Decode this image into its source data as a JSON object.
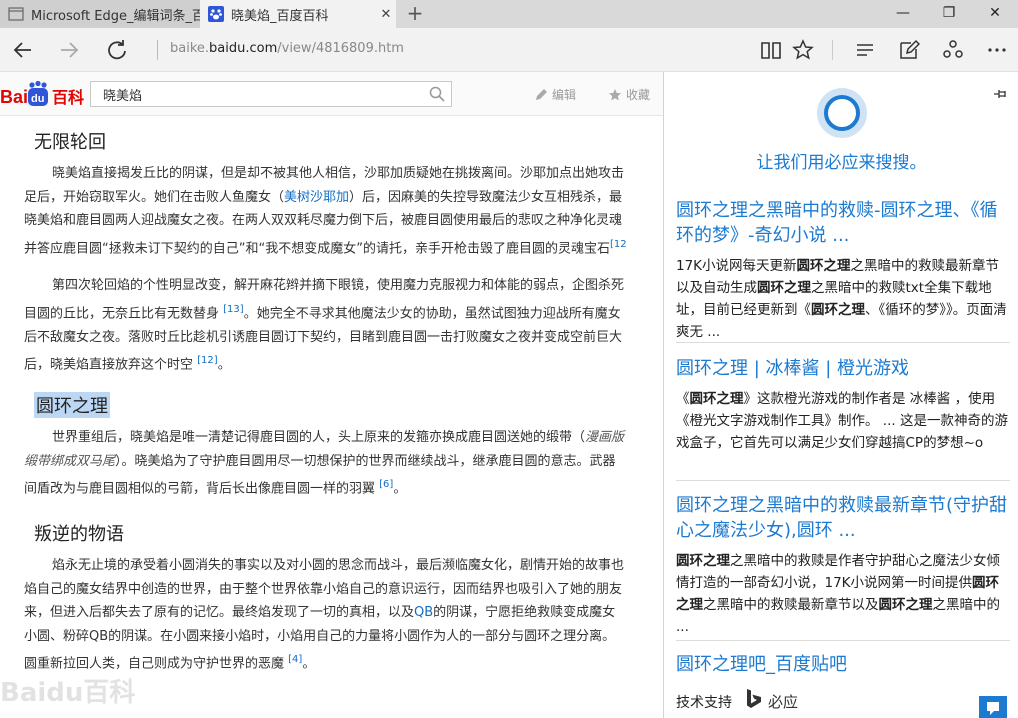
{
  "tabs": [
    {
      "title": "Microsoft Edge_编辑词条_百",
      "active": false
    },
    {
      "title": "晓美焰_百度百科",
      "active": true
    }
  ],
  "window": {
    "new_tab": "+",
    "minimize": "—",
    "restore": "❐",
    "close": "✕"
  },
  "address": {
    "host_prefix": "baike.",
    "host": "baidu.com",
    "path": "/view/4816809.htm"
  },
  "baike": {
    "logo_text_bai": "Bai",
    "logo_text_du": "du",
    "logo_text_baike": "百科",
    "search_value": "晓美焰",
    "edit_label": "编辑",
    "favorite_label": "收藏"
  },
  "article": {
    "section1": {
      "title": "无限轮回",
      "p1": {
        "l1": "晓美焰直接揭发丘比的阴谋，但是却不被其他人相信，沙耶加质疑她在挑拨离间。沙耶加点出她攻击",
        "l2a": "足后，开始窃取军火。她们在击败人鱼魔女（",
        "l2link": "美树沙耶加",
        "l2b": "）后，因麻美的失控导致魔法少女互相残杀，最",
        "l3": "晓美焰和鹿目圆两人迎战魔女之夜。在两人双双耗尽魔力倒下后，被鹿目圆使用最后的悲叹之种净化灵魂",
        "l4": "并答应鹿目圆“拯救未订下契约的自己”和“我不想变成魔女”的请托，亲手开枪击毁了鹿目圆的灵魂宝石",
        "l4ref": "[12"
      },
      "p2": {
        "l1": "第四次轮回焰的个性明显改变，解开麻花辫并摘下眼镜，使用魔力克服视力和体能的弱点，企图杀死",
        "l2": "目圆的丘比，无奈丘比有无数替身",
        "l2ref": "[13]",
        "l2b": "。她完全不寻求其他魔法少女的协助，虽然试图独力迎战所有魔女",
        "l3": "后不敌魔女之夜。落败时丘比趁机引诱鹿目圆订下契约，目睹到鹿目圆一击打败魔女之夜并变成空前巨大",
        "l4": "后，晓美焰直接放弃这个时空",
        "l4ref": "[12]",
        "l4b": "。"
      }
    },
    "section2": {
      "title": "圆环之理",
      "p1": {
        "l1": "世界重组后，晓美焰是唯一清楚记得鹿目圆的人，头上原来的发箍亦换成鹿目圆送她的缎带（",
        "l1ital": "漫画版",
        "l2ital": "缎带绑成双马尾",
        "l2": "）。晓美焰为了守护鹿目圆用尽一切想保护的世界而继续战斗，继承鹿目圆的意志。武器",
        "l3": "间盾改为与鹿目圆相似的弓箭，背后长出像鹿目圆一样的羽翼",
        "l3ref": "[6]",
        "l3b": "。"
      }
    },
    "section3": {
      "title": "叛逆的物语",
      "p1": {
        "l1": "焰永无止境的承受着小圆消失的事实以及对小圆的思念而战斗，最后濒临魔女化，剧情开始的故事也",
        "l2": "焰自己的魔女结界中创造的世界，由于整个世界依靠小焰自己的意识运行，因而结界也吸引入了她的朋友",
        "l3a": "来，但进入后都失去了原有的记忆。最终焰发现了一切的真相，以及",
        "l3link": "QB",
        "l3b": "的阴谋，宁愿拒绝救赎变成魔女",
        "l4": "小圆、粉碎QB的阴谋。在小圆来接小焰时，小焰用自己的力量将小圆作为人的一部分与圆环之理分离。",
        "l5": "圆重新拉回人类，自己则成为守护世界的恶魔",
        "l5ref": "[4]",
        "l5b": "。"
      }
    },
    "watermark": "Baidu百科"
  },
  "cortana": {
    "prompt": "让我们用必应来搜搜。",
    "results": [
      {
        "title": "圆环之理之黑暗中的救赎-圆环之理、《循环的梦》-奇幻小说 ...",
        "d1": "17K小说网每天更新",
        "d1b": "圆环之理",
        "d2": "之黑暗中的救赎最新章节以及自动生成",
        "d2b": "圆环之理",
        "d3": "之黑暗中的救赎txt全集下载地址，目前已经更新到《",
        "d3b": "圆环之理",
        "d4": "、《循环的梦》》。页面清爽无 ..."
      },
      {
        "title": "圆环之理 | 冰棒酱 | 橙光游戏",
        "d1": "《",
        "d1b": "圆环之理",
        "d2": "》这款橙光游戏的制作者是 冰棒酱 ，使用《橙光文字游戏制作工具》制作。 ... 这是一款神奇的游戏盒子，它首先可以满足少女们穿越搞CP的梦想~o"
      },
      {
        "title": "圆环之理之黑暗中的救赎最新章节(守护甜心之魔法少女),圆环 ...",
        "d1b": "圆环之理",
        "d1": "之黑暗中的救赎是作者守护甜心之魔法少女倾情打造的一部奇幻小说，17K小说网第一时间提供",
        "d2b": "圆环之理",
        "d2": "之黑暗中的救赎最新章节以及",
        "d3b": "圆环之理",
        "d3": "之黑暗中的 ..."
      },
      {
        "title": "圆环之理吧_百度贴吧"
      }
    ],
    "footer_label": "技术支持",
    "footer_engine": "必应"
  }
}
